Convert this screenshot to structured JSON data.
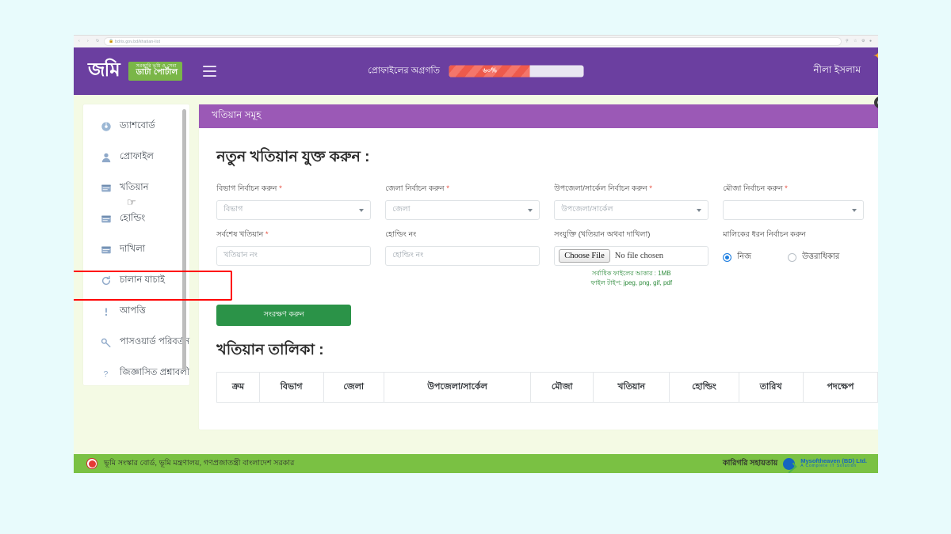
{
  "browser": {
    "url": "bdris.gov.bd/khatian-list",
    "back_icon": "back-arrow-icon",
    "forward_icon": "forward-arrow-icon",
    "reload_icon": "reload-icon",
    "lock_icon": "lock-icon"
  },
  "header": {
    "logo_main": "জমি",
    "logo_tagline_line1": "সরকারি ভূমি ও সেবা",
    "logo_tagline_line2": "ডাটা পোর্টাল",
    "menu_icon": "hamburger-menu-icon",
    "progress_label": "প্রোফাইলের অগ্রগতি",
    "progress_value": "৬০%",
    "progress_percent": 60,
    "user_name": "নীলা ইসলাম",
    "bg_color": "#6b3fa0"
  },
  "sidebar": {
    "items": [
      {
        "label": "ড্যাশবোর্ড",
        "icon": "dashboard-icon"
      },
      {
        "label": "প্রোফাইল",
        "icon": "user-icon"
      },
      {
        "label": "খতিয়ান",
        "icon": "book-icon"
      },
      {
        "label": "হোল্ডিং",
        "icon": "book-icon"
      },
      {
        "label": "দাখিলা",
        "icon": "book-icon"
      },
      {
        "label": "চালান যাচাই",
        "icon": "refresh-icon"
      },
      {
        "label": "আপত্তি",
        "icon": "exclamation-icon"
      },
      {
        "label": "পাসওয়ার্ড পরিবর্তন",
        "icon": "key-icon"
      },
      {
        "label": "জিজ্ঞাসিত প্রশ্নাবলী",
        "icon": "question-mark-icon"
      }
    ],
    "highlight_color": "#ff0000",
    "cursor_icon": "hand-pointer-cursor"
  },
  "panel": {
    "header_title": "খতিয়ান সমূহ",
    "header_color": "#9b59b6",
    "form_title": "নতুন খতিয়ান যুক্ত করুন :",
    "fields": {
      "division": {
        "label": "বিভাগ নির্বাচন করুন",
        "required": true,
        "value": "বিভাগ"
      },
      "district": {
        "label": "জেলা নির্বাচন করুন",
        "required": true,
        "value": "জেলা"
      },
      "upazila": {
        "label": "উপজেলা/সার্কেল নির্বাচন করুন",
        "required": true,
        "value": "উপজেলা/সার্কেল"
      },
      "mouza": {
        "label": "মৌজা নির্বাচন করুন",
        "required": true,
        "value": ""
      },
      "khatian": {
        "label": "সর্বশেষ খতিয়ান",
        "required": true,
        "placeholder": "খতিয়ান নং",
        "value": ""
      },
      "holding": {
        "label": "হোল্ডিং নং",
        "required": false,
        "placeholder": "হোল্ডিং নং",
        "value": ""
      },
      "attachment": {
        "label": "সংযুক্তি (খতিয়ান অথবা দাখিলা)",
        "required": false,
        "choose_button": "Choose File",
        "no_file_text": "No file chosen",
        "hint_size": "সর্বাধিক ফাইলের আকার : 1MB",
        "hint_types": "ফাইল টাইপ: jpeg, png, gif, pdf",
        "hint_color": "#2e8b3c"
      },
      "owner_type": {
        "label": "মালিকের ধরন নির্বাচন করুন",
        "options": [
          {
            "label": "নিজ",
            "selected": true
          },
          {
            "label": "উত্তরাধিকার",
            "selected": false
          }
        ],
        "accent_color": "#1f7fe0"
      }
    },
    "save_button": "সংরক্ষণ করুন",
    "save_button_color": "#2b9348",
    "list_title": "খতিয়ান তালিকা :",
    "table": {
      "columns": [
        "ক্রম",
        "বিভাগ",
        "জেলা",
        "উপজেলা/সার্কেল",
        "মৌজা",
        "খতিয়ান",
        "হোল্ডিং",
        "তারিখ",
        "পদক্ষেপ"
      ],
      "rows": []
    },
    "widget_icon": "circular-widget-icon"
  },
  "footer": {
    "left_text": "ভূমি সংস্কার বোর্ড, ভূমি মন্ত্রণালয়, গণপ্রজাতন্ত্রী বাংলাদেশ সরকার",
    "seal_icon": "government-seal-icon",
    "tech_label": "কারিগরি সহায়তায়",
    "vendor_name": "Mysoftheaven (BD) Ltd.",
    "vendor_tagline": "A Complete IT Solution",
    "bg_color": "#7ac143"
  }
}
